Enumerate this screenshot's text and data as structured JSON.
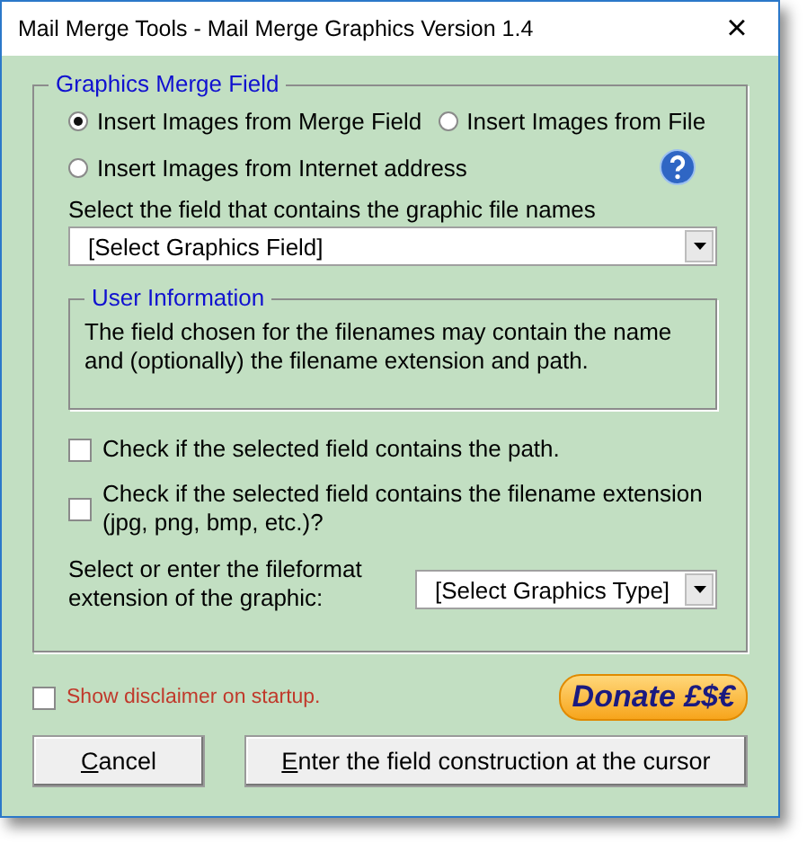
{
  "window": {
    "title": "Mail Merge Tools - Mail Merge Graphics Version 1.4",
    "close": "×"
  },
  "group": {
    "title": "Graphics Merge Field",
    "sources": [
      {
        "label": "Insert Images from Merge Field",
        "selected": true
      },
      {
        "label": "Insert Images from File",
        "selected": false
      },
      {
        "label": "Insert Images from Internet address",
        "selected": false
      }
    ],
    "field_label": "Select the field that contains the graphic file names",
    "field_combo": {
      "value": "[Select Graphics Field]"
    },
    "info": {
      "title": "User Information",
      "text": "The field chosen for the filenames may contain the name and (optionally) the filename extension and path."
    },
    "checks": [
      {
        "label": "Check if the selected field contains the path.",
        "checked": false
      },
      {
        "label": "Check if the selected field contains the filename extension (jpg, png, bmp, etc.)?",
        "checked": false
      }
    ],
    "format_label": "Select or enter the fileformat extension of the graphic:",
    "format_combo": {
      "value": "[Select Graphics Type]"
    }
  },
  "disclaimer": {
    "label": "Show disclaimer on startup.",
    "checked": false
  },
  "donate": "Donate £$€",
  "buttons": [
    {
      "label": "Cancel",
      "mnemonic": true
    },
    {
      "label": "Enter the field construction at the cursor",
      "mnemonic": true
    }
  ]
}
